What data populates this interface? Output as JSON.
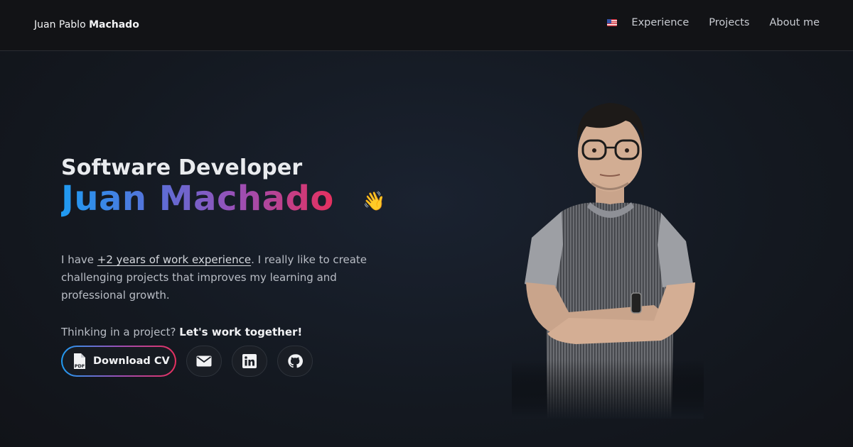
{
  "header": {
    "brand_first": "Juan Pablo",
    "brand_last": "Machado",
    "nav": [
      {
        "label": "Experience"
      },
      {
        "label": "Projects"
      },
      {
        "label": "About me"
      }
    ],
    "language_icon": "us-flag-icon"
  },
  "hero": {
    "role": "Software Developer",
    "name": "Juan Machado",
    "wave_emoji": "👋",
    "intro_before": "I have ",
    "intro_highlight": "+2 years of work experience",
    "intro_after": ". I really like to create challenging projects that improves my learning and professional growth.",
    "cta_text": "Thinking in a project? ",
    "cta_bold": "Let's work together!",
    "download_label": "Download CV",
    "social": [
      {
        "icon": "envelope-icon"
      },
      {
        "icon": "linkedin-icon"
      },
      {
        "icon": "github-icon"
      }
    ]
  },
  "colors": {
    "gradient": [
      "#1f9bf2",
      "#5a6fd8",
      "#9b4fb5",
      "#e6305e"
    ],
    "header_bg": "#121316",
    "page_bg": "#141921"
  }
}
